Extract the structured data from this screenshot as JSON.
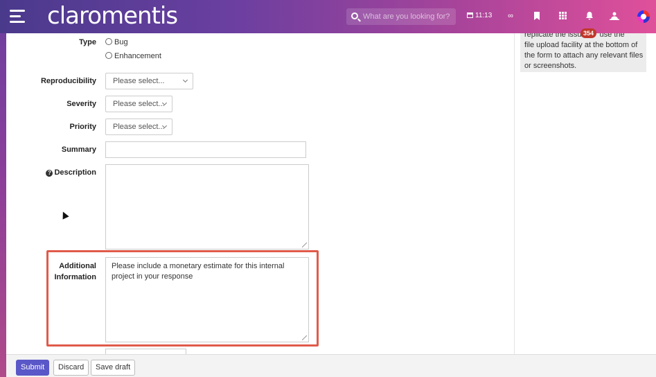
{
  "app": {
    "name": "claromentis"
  },
  "search": {
    "placeholder": "What are you looking for?"
  },
  "header": {
    "time": "11:13"
  },
  "help": {
    "line1": "replicate the issu",
    "line1b": "use the",
    "line2": "file upload facility at the bottom of",
    "line3": "the form to attach any relevant files",
    "line4": "or screenshots.",
    "badge": "354"
  },
  "form": {
    "type_label": "Type",
    "type_options": [
      "Bug",
      "Enhancement"
    ],
    "reproducibility_label": "Reproducibility",
    "reproducibility_value": "Please select...",
    "severity_label": "Severity",
    "severity_value": "Please select...",
    "priority_label": "Priority",
    "priority_value": "Please select...",
    "summary_label": "Summary",
    "description_label": "Description",
    "additional_label_1": "Additional",
    "additional_label_2": "Information",
    "additional_value": "Please include a monetary estimate for this internal project in your response"
  },
  "footer": {
    "submit": "Submit",
    "discard": "Discard",
    "save_draft": "Save draft"
  },
  "colors": {
    "primary_button": "#5a57c8",
    "highlight_border": "#e05a4a"
  }
}
